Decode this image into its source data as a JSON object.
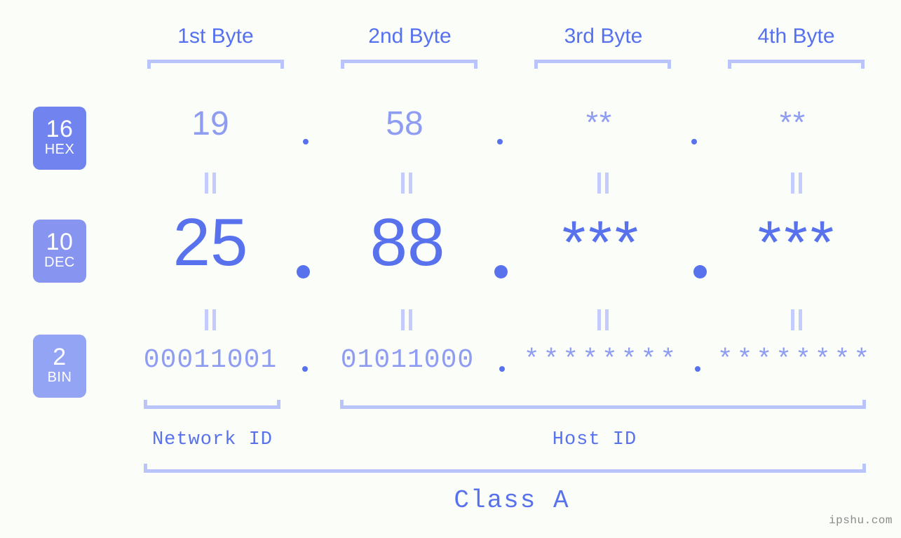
{
  "page": {
    "background_color": "#fbfdf8",
    "accent_color": "#5872ed",
    "light_accent_color": "#b9c4fb",
    "muted_accent_color": "#8e9cf2"
  },
  "headers": {
    "byte1": "1st Byte",
    "byte2": "2nd Byte",
    "byte3": "3rd Byte",
    "byte4": "4th Byte"
  },
  "bases": [
    {
      "num": "16",
      "name": "HEX",
      "color": "#7083ee"
    },
    {
      "num": "10",
      "name": "DEC",
      "color": "#8795f1"
    },
    {
      "num": "2",
      "name": "BIN",
      "color": "#93a4f4"
    }
  ],
  "rows": {
    "hex": {
      "b1": "19",
      "b2": "58",
      "b3": "**",
      "b4": "**"
    },
    "dec": {
      "b1": "25",
      "b2": "88",
      "b3": "***",
      "b4": "***"
    },
    "bin": {
      "b1": "00011001",
      "b2": "01011000",
      "b3": "********",
      "b4": "********"
    }
  },
  "separators": {
    "dot": ".",
    "equals": "="
  },
  "segments": {
    "network_id": "Network ID",
    "host_id": "Host ID",
    "class": "Class A"
  },
  "watermark": "ipshu.com"
}
